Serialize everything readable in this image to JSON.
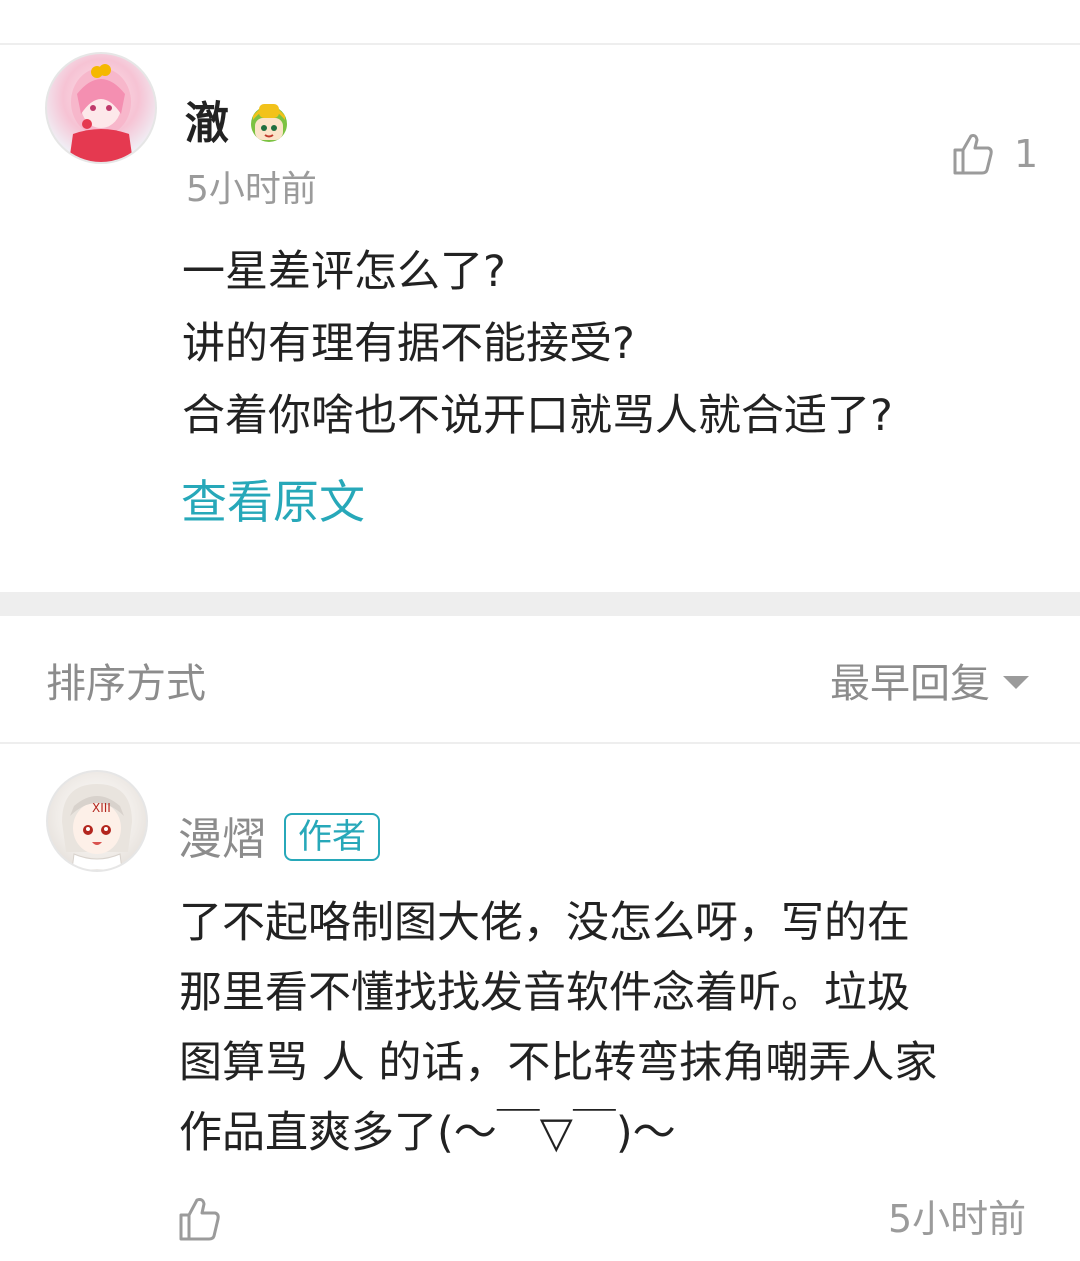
{
  "main_comment": {
    "username": "澈",
    "time": "5小时前",
    "like_count": "1",
    "lines": [
      "一星差评怎么了?",
      "讲的有理有据不能接受?",
      "合着你啥也不说开口就骂人就合适了?"
    ],
    "view_original": "查看原文",
    "avatar_icon": "anime-girl-avatar",
    "badge_icon": "green-hair-character-badge-icon"
  },
  "sort_bar": {
    "label": "排序方式",
    "value": "最早回复"
  },
  "reply": {
    "username": "漫熠",
    "author_tag": "作者",
    "lines": [
      "了不起咯制图大佬，没怎么呀，写的在",
      "那里看不懂找找发音软件念着听。垃圾",
      "图算骂 人 的话，不比转弯抹角嘲弄人家",
      "作品直爽多了(～￣▽￣)～"
    ],
    "time": "5小时前",
    "avatar_icon": "white-hair-character-avatar"
  },
  "colors": {
    "accent": "#27a8b9",
    "muted_text": "#9b9b9b",
    "divider": "#eeeeee"
  }
}
